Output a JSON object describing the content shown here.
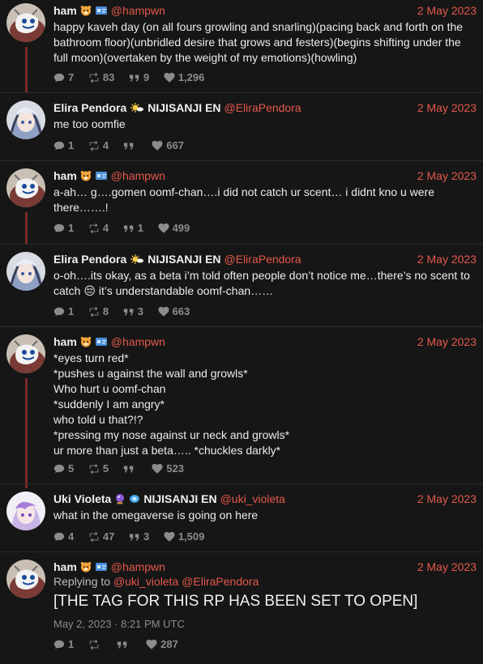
{
  "tweets": [
    {
      "name": "ham",
      "org": "",
      "handle": "@hampwn",
      "date": "2 May 2023",
      "text": "happy kaveh day (on all fours growling and snarling)(pacing back and forth on the bathroom floor)(unbridled desire that grows and festers)(begins shifting under the full moon)(overtaken by the weight of my emotions)(howling)",
      "replies": "7",
      "retweets": "83",
      "quotes": "9",
      "likes": "1,296"
    },
    {
      "name": "Elira Pendora",
      "org": "NIJISANJI EN",
      "handle": "@EliraPendora",
      "date": "2 May 2023",
      "text": "me too oomfie",
      "replies": "1",
      "retweets": "4",
      "quotes": "",
      "likes": "667"
    },
    {
      "name": "ham",
      "org": "",
      "handle": "@hampwn",
      "date": "2 May 2023",
      "text": "a-ah… g….gomen oomf-chan….i did not catch ur scent… i didnt kno u were there…….!",
      "replies": "1",
      "retweets": "4",
      "quotes": "1",
      "likes": "499"
    },
    {
      "name": "Elira Pendora",
      "org": "NIJISANJI EN",
      "handle": "@EliraPendora",
      "date": "2 May 2023",
      "text": "o-oh….its okay, as a beta i’m told often people don’t notice me…there’s no scent to catch 😔 it’s understandable oomf-chan……",
      "replies": "1",
      "retweets": "8",
      "quotes": "3",
      "likes": "663"
    },
    {
      "name": "ham",
      "org": "",
      "handle": "@hampwn",
      "date": "2 May 2023",
      "text": "*eyes turn red*\n*pushes u against the wall and growls*\nWho hurt u oomf-chan\n*suddenly I am angry*\nwho told u that?!?\n*pressing my nose against ur neck and growls*\nur more than just a beta….. *chuckles darkly*",
      "replies": "5",
      "retweets": "5",
      "quotes": "",
      "likes": "523"
    },
    {
      "name": "Uki Violeta",
      "org": "NIJISANJI EN",
      "handle": "@uki_violeta",
      "date": "2 May 2023",
      "text": "what in the omegaverse is going on here",
      "replies": "4",
      "retweets": "47",
      "quotes": "3",
      "likes": "1,509"
    },
    {
      "name": "ham",
      "org": "",
      "handle": "@hampwn",
      "date": "2 May 2023",
      "replying_prefix": "Replying to",
      "replying_to_1": "@uki_violeta",
      "replying_to_2": "@EliraPendora",
      "text": "[THE TAG FOR THIS RP HAS BEEN SET TO OPEN]",
      "timestamp": "May 2, 2023 · 8:21 PM UTC",
      "replies": "1",
      "retweets": "",
      "quotes": "",
      "likes": "287"
    }
  ],
  "colors": {
    "background": "#161616",
    "accent": "#e4584b",
    "thread_line": "#7a2a2a",
    "muted": "#8c8c8c"
  },
  "icons": [
    "comment-icon",
    "retweet-icon",
    "quote-icon",
    "heart-icon",
    "hamster-emoji-icon",
    "id-card-emoji-icon",
    "sun-emoji-icon",
    "purple-orb-emoji-icon",
    "blue-gem-emoji-icon"
  ]
}
